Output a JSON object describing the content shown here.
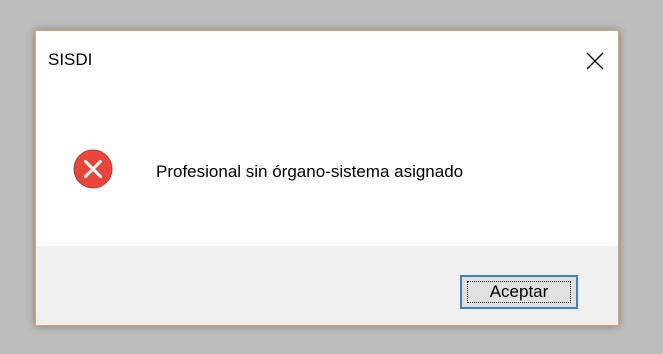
{
  "window": {
    "title": "SISDI",
    "close_icon": "close-icon"
  },
  "message": {
    "icon": "error-icon",
    "icon_color": "#e8453c",
    "text": "Profesional sin órgano-sistema asignado"
  },
  "buttons": {
    "ok_label": "Aceptar"
  },
  "colors": {
    "dialog_border": "#e8a25c",
    "footer_background": "#f0f0f0",
    "button_focus_border": "#3c7fd4"
  }
}
